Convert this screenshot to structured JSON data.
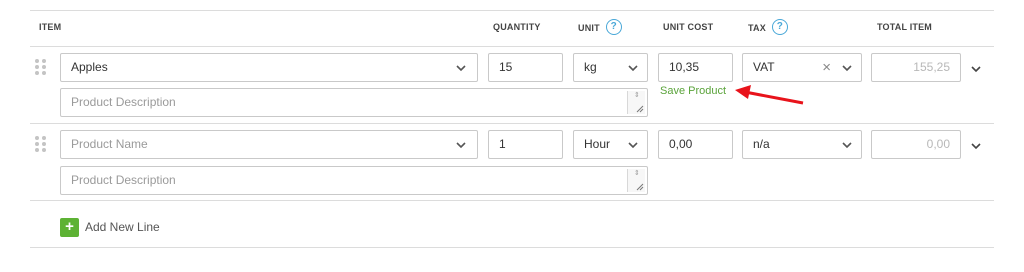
{
  "header": {
    "item": "ITEM",
    "quantity": "QUANTITY",
    "unit": "UNIT",
    "unit_cost": "UNIT COST",
    "tax": "TAX",
    "total_item": "TOTAL ITEM",
    "help_icon_glyph": "?"
  },
  "rows": [
    {
      "product": "Apples",
      "description_placeholder": "Product Description",
      "quantity": "15",
      "unit": "kg",
      "unit_cost": "10,35",
      "tax": "VAT",
      "tax_clear_glyph": "×",
      "total": "155,25",
      "save_product": "Save Product"
    },
    {
      "product_placeholder": "Product Name",
      "description_placeholder": "Product Description",
      "quantity": "1",
      "unit": "Hour",
      "unit_cost": "0,00",
      "tax": "n/a",
      "total": "0,00"
    }
  ],
  "footer": {
    "add_icon": "+",
    "add_label": "Add New Line"
  },
  "colors": {
    "accent_green": "#5db234",
    "help_blue": "#4aa8d8",
    "annotation_red": "#e8131b"
  },
  "icons": [
    "drag-handle-icon",
    "chevron-down-icon",
    "help-icon",
    "clear-icon",
    "resize-handle-icon",
    "plus-icon",
    "arrow-annotation-icon"
  ]
}
